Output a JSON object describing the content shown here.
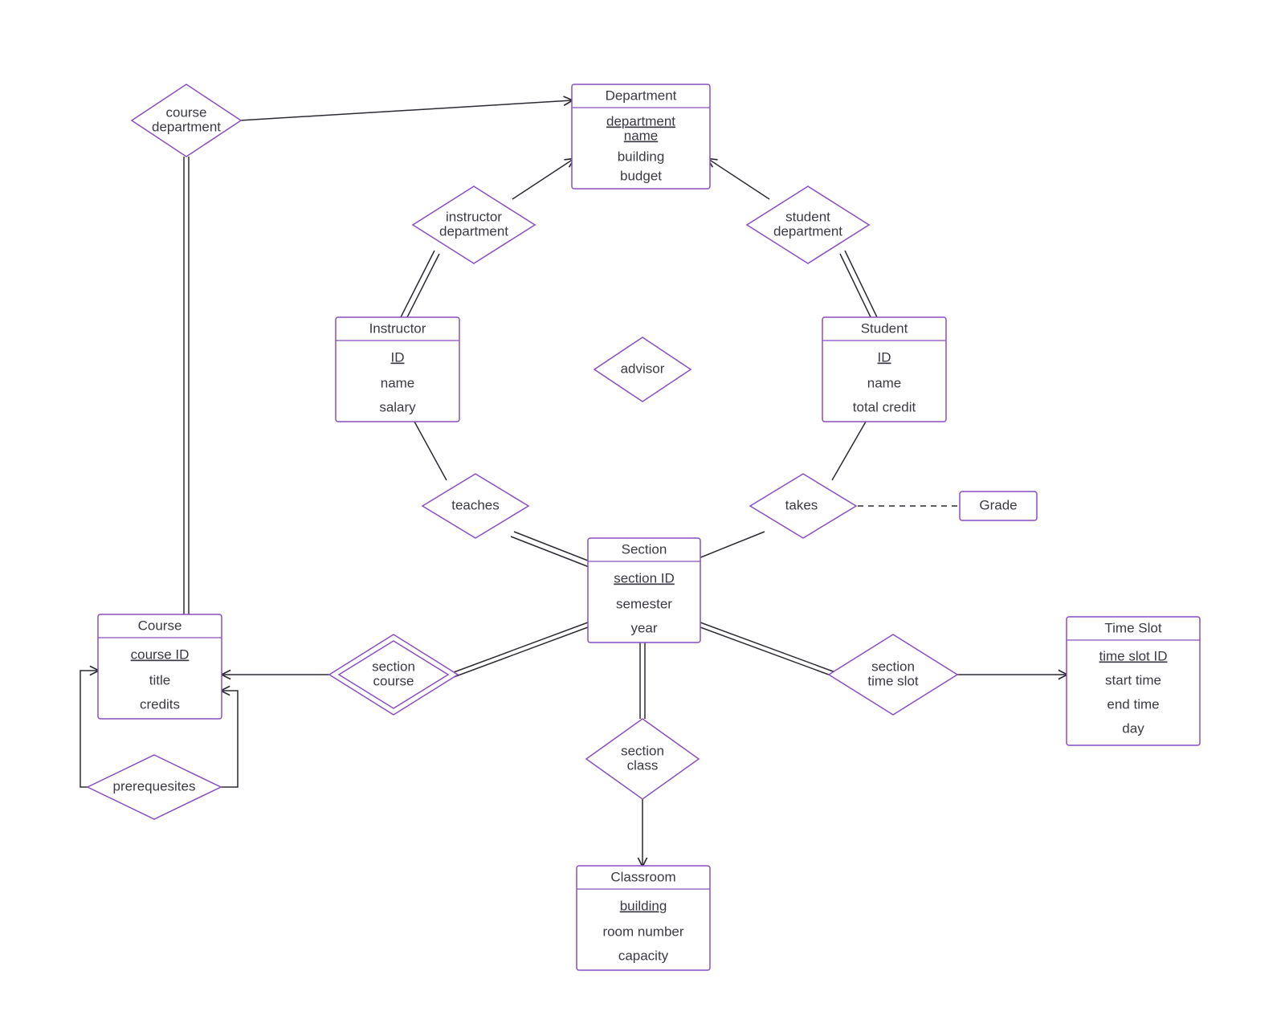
{
  "entities": {
    "department": {
      "title": "Department",
      "pk": "department name",
      "attrs": [
        "building",
        "budget"
      ]
    },
    "instructor": {
      "title": "Instructor",
      "pk": "ID",
      "attrs": [
        "name",
        "salary"
      ]
    },
    "student": {
      "title": "Student",
      "pk": "ID",
      "attrs": [
        "name",
        "total credit"
      ]
    },
    "section": {
      "title": "Section",
      "pk": "section ID",
      "attrs": [
        "semester",
        "year"
      ]
    },
    "course": {
      "title": "Course",
      "pk": "course ID",
      "attrs": [
        "title",
        "credits"
      ]
    },
    "classroom": {
      "title": "Classroom",
      "pk": "building",
      "attrs": [
        "room number",
        "capacity"
      ]
    },
    "timeslot": {
      "title": "Time Slot",
      "pk": "time slot ID",
      "attrs": [
        "start time",
        "end time",
        "day"
      ]
    }
  },
  "relationships": {
    "course_department": {
      "label1": "course",
      "label2": "department"
    },
    "instructor_department": {
      "label1": "instructor",
      "label2": "department"
    },
    "student_department": {
      "label1": "student",
      "label2": "department"
    },
    "advisor": {
      "label": "advisor"
    },
    "teaches": {
      "label": "teaches"
    },
    "takes": {
      "label": "takes"
    },
    "section_course": {
      "label1": "section",
      "label2": "course"
    },
    "section_class": {
      "label1": "section",
      "label2": "class"
    },
    "section_timeslot": {
      "label1": "section",
      "label2": "time slot"
    },
    "prerequisites": {
      "label": "prerequesites"
    }
  },
  "grade_label": "Grade"
}
